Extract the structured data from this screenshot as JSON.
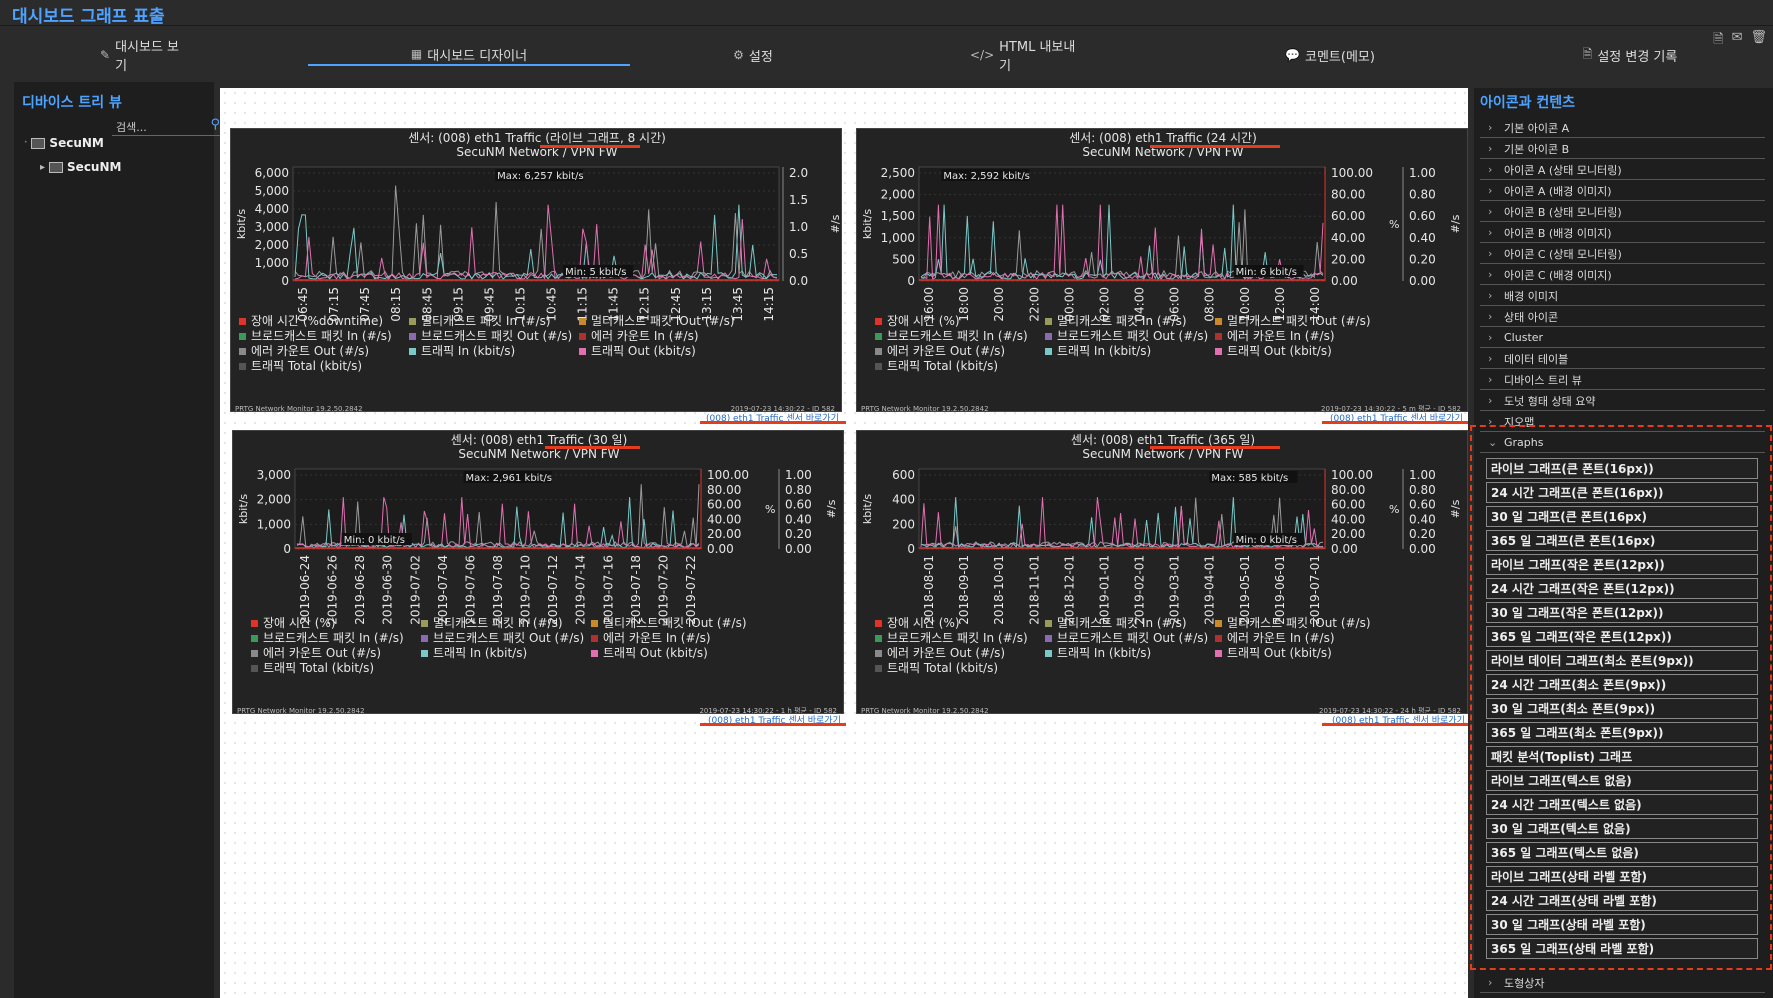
{
  "app": {
    "title": "대시보드 그래프 표출"
  },
  "toolbar_icons": [
    "file-icon",
    "mail-icon",
    "trash-icon"
  ],
  "tabs": [
    {
      "label": "대시보드 보기",
      "icon": "edit-icon"
    },
    {
      "label": "대시보드 디자이너",
      "icon": "grid-icon",
      "active": true
    },
    {
      "label": "설정",
      "icon": "gear-icon"
    },
    {
      "label": "HTML 내보내기",
      "icon": "code-icon"
    },
    {
      "label": "코멘트(메모)",
      "icon": "comment-icon"
    },
    {
      "label": "설정 변경 기록",
      "icon": "document-icon"
    }
  ],
  "device_tree": {
    "title": "디바이스 트리 뷰",
    "search_placeholder": "검색...",
    "items": [
      "SecuNM",
      "SecuNM"
    ]
  },
  "graphs": [
    {
      "title": "센서: (008) eth1 Traffic (라이브 그래프, 8 시간)",
      "subtitle": "SecuNM Network / VPN FW",
      "max_label": "Max: 6,257 kbit/s",
      "min_label": "Min: 5 kbit/s",
      "y_left_label": "kbit/s",
      "y_right_label": "#/s",
      "y_left_ticks": [
        "6,000",
        "5,000",
        "4,000",
        "3,000",
        "2,000",
        "1,000",
        "0"
      ],
      "y_right_ticks": [
        "2.0",
        "1.5",
        "1.0",
        "0.5",
        "0.0"
      ],
      "x_ticks": [
        "06:45",
        "07:15",
        "07:45",
        "08:15",
        "08:45",
        "09:15",
        "09:45",
        "10:15",
        "10:45",
        "11:15",
        "11:45",
        "12:15",
        "12:45",
        "13:15",
        "13:45",
        "14:15"
      ],
      "legend": [
        "장애 시간 (%downtime)",
        "멀티캐스트 패킷 In (#/s)",
        "멀티캐스트 패킷 iOut (#/s)",
        "브로드캐스트 패킷 In (#/s)",
        "브로드캐스트 패킷 Out (#/s)",
        "에러 카운트 In (#/s)",
        "에러 카운트 Out (#/s)",
        "트래픽 In (kbit/s)",
        "트래픽 Out (kbit/s)",
        "트래픽 Total (kbit/s)"
      ],
      "footer_left": "PRTG Network Monitor 19.2.50.2842",
      "footer_right": "2019-07-23 14:30:22 - ID 582",
      "link": "(008) eth1 Traffic 센서 바로가기"
    },
    {
      "title": "센서: (008) eth1 Traffic (24 시간)",
      "subtitle": "SecuNM Network / VPN FW",
      "max_label": "Max: 2,592 kbit/s",
      "min_label": "Min: 6 kbit/s",
      "y_left_label": "kbit/s",
      "y_mid_label": "%",
      "y_right_label": "#/s",
      "y_left_ticks": [
        "2,500",
        "2,000",
        "1,500",
        "1,000",
        "500",
        "0"
      ],
      "y_mid_ticks": [
        "100.00",
        "80.00",
        "60.00",
        "40.00",
        "20.00",
        "0.00"
      ],
      "y_right_ticks": [
        "1.00",
        "0.80",
        "0.60",
        "0.40",
        "0.20",
        "0.00"
      ],
      "x_ticks": [
        "16:00",
        "18:00",
        "20:00",
        "22:00",
        "00:00",
        "02:00",
        "04:00",
        "06:00",
        "08:00",
        "10:00",
        "12:00",
        "14:00"
      ],
      "legend": [
        "장애 시간 (%)",
        "멀티캐스트 패킷 In (#/s)",
        "멀티캐스트 패킷 iOut (#/s)",
        "브로드캐스트 패킷 In (#/s)",
        "브로드캐스트 패킷 Out (#/s)",
        "에러 카운트 In (#/s)",
        "에러 카운트 Out (#/s)",
        "트래픽 In (kbit/s)",
        "트래픽 Out (kbit/s)",
        "트래픽 Total (kbit/s)"
      ],
      "footer_left": "PRTG Network Monitor 19.2.50.2842",
      "footer_right": "2019-07-23 14:30:22 - 5 m 평균 - ID 582",
      "link": "(008) eth1 Traffic 센서 바로가기"
    },
    {
      "title": "센서: (008) eth1 Traffic (30 일)",
      "subtitle": "SecuNM Network / VPN FW",
      "max_label": "Max: 2,961 kbit/s",
      "min_label": "Min: 0 kbit/s",
      "y_left_label": "kbit/s",
      "y_mid_label": "%",
      "y_right_label": "#/s",
      "y_left_ticks": [
        "3,000",
        "2,000",
        "1,000",
        "0"
      ],
      "y_mid_ticks": [
        "100.00",
        "80.00",
        "60.00",
        "40.00",
        "20.00",
        "0.00"
      ],
      "y_right_ticks": [
        "1.00",
        "0.80",
        "0.60",
        "0.40",
        "0.20",
        "0.00"
      ],
      "x_ticks": [
        "2019-06-24",
        "2019-06-26",
        "2019-06-28",
        "2019-06-30",
        "2019-07-02",
        "2019-07-04",
        "2019-07-06",
        "2019-07-08",
        "2019-07-10",
        "2019-07-12",
        "2019-07-14",
        "2019-07-16",
        "2019-07-18",
        "2019-07-20",
        "2019-07-22"
      ],
      "legend": [
        "장애 시간 (%)",
        "멀티캐스트 패킷 In (#/s)",
        "멀티캐스트 패킷 iOut (#/s)",
        "브로드캐스트 패킷 In (#/s)",
        "브로드캐스트 패킷 Out (#/s)",
        "에러 카운트 In (#/s)",
        "에러 카운트 Out (#/s)",
        "트래픽 In (kbit/s)",
        "트래픽 Out (kbit/s)",
        "트래픽 Total (kbit/s)"
      ],
      "footer_left": "PRTG Network Monitor 19.2.50.2842",
      "footer_right": "2019-07-23 14:30:22 - 1 h 평균 - ID 582",
      "link": "(008) eth1 Traffic 센서 바로가기"
    },
    {
      "title": "센서: (008) eth1 Traffic (365 일)",
      "subtitle": "SecuNM Network / VPN FW",
      "max_label": "Max: 585 kbit/s",
      "min_label": "Min: 0 kbit/s",
      "y_left_label": "kbit/s",
      "y_mid_label": "%",
      "y_right_label": "#/s",
      "y_left_ticks": [
        "600",
        "400",
        "200",
        "0"
      ],
      "y_mid_ticks": [
        "100.00",
        "80.00",
        "60.00",
        "40.00",
        "20.00",
        "0.00"
      ],
      "y_right_ticks": [
        "1.00",
        "0.80",
        "0.60",
        "0.40",
        "0.20",
        "0.00"
      ],
      "x_ticks": [
        "2018-08-01",
        "2018-09-01",
        "2018-10-01",
        "2018-11-01",
        "2018-12-01",
        "2019-01-01",
        "2019-02-01",
        "2019-03-01",
        "2019-04-01",
        "2019-05-01",
        "2019-06-01",
        "2019-07-01"
      ],
      "legend": [
        "장애 시간 (%)",
        "멀티캐스트 패킷 In (#/s)",
        "멀티캐스트 패킷 iOut (#/s)",
        "브로드캐스트 패킷 In (#/s)",
        "브로드캐스트 패킷 Out (#/s)",
        "에러 카운트 In (#/s)",
        "에러 카운트 Out (#/s)",
        "트래픽 In (kbit/s)",
        "트래픽 Out (kbit/s)",
        "트래픽 Total (kbit/s)"
      ],
      "footer_left": "PRTG Network Monitor 19.2.50.2842",
      "footer_right": "2019-07-23 14:30:22 - 24 h 평균 - ID 582",
      "link": "(008) eth1 Traffic 센서 바로가기"
    }
  ],
  "legend_colors": [
    "#e0342a",
    "#9a9a5a",
    "#c98a2a",
    "#3a9a5a",
    "#8a6ab0",
    "#b03030",
    "#8a8a8a",
    "#7ac8c8",
    "#e070b0",
    "#555555"
  ],
  "icons_panel": {
    "title": "아이콘과 컨텐츠",
    "sections": [
      "기본 아이콘 A",
      "기본 아이콘 B",
      "아이콘 A (상태 모니터링)",
      "아이콘 A (배경 이미지)",
      "아이콘 B (상태 모니터링)",
      "아이콘 B (배경 이미지)",
      "아이콘 C (상태 모니터링)",
      "아이콘 C (배경 이미지)",
      "배경 이미지",
      "상태 아이콘",
      "Cluster",
      "데이터 테이블",
      "디바이스 트리 뷰",
      "도넛 형태 상태 요약",
      "지오맵"
    ],
    "graphs_section": "Graphs",
    "graph_items": [
      "라이브 그래프(큰 폰트(16px))",
      "24 시간 그래프(큰 폰트(16px))",
      "30 일 그래프(큰 폰트(16px)",
      "365 일 그래프(큰 폰트(16px)",
      "라이브 그래프(작은 폰트(12px))",
      "24 시간 그래프(작은 폰트(12px))",
      "30 일 그래프(작은 폰트(12px))",
      "365 일 그래프(작은 폰트(12px))",
      "라이브 데이터 그래프(최소 폰트(9px))",
      "24 시간 그래프(최소 폰트(9px))",
      "30 일 그래프(최소 폰트(9px))",
      "365 일 그래프(최소 폰트(9px))",
      "패킷 분석(Toplist) 그래프",
      "라이브 그래프(텍스트 없음)",
      "24 시간 그래프(텍스트 없음)",
      "30 일 그래프(텍스트 없음)",
      "365 일 그래프(텍스트 없음)",
      "라이브 그래프(상태 라벨 포함)",
      "24 시간 그래프(상태 라벨 포함)",
      "30 일 그래프(상태 라벨 포함)",
      "365 일 그래프(상태 라벨 포함)"
    ],
    "last_section": "도형상자"
  }
}
